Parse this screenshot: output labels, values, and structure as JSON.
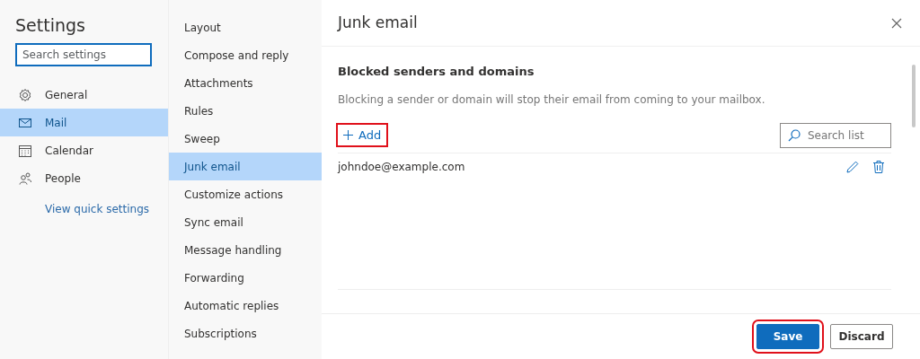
{
  "sidebar": {
    "title": "Settings",
    "search": {
      "placeholder": "Search settings"
    },
    "items": [
      {
        "label": "General",
        "kind": "gear",
        "selected": false
      },
      {
        "label": "Mail",
        "kind": "mail",
        "selected": true
      },
      {
        "label": "Calendar",
        "kind": "calendar",
        "selected": false
      },
      {
        "label": "People",
        "kind": "people",
        "selected": false
      }
    ],
    "link": "View quick settings"
  },
  "subnav": {
    "items": [
      {
        "label": "Layout",
        "selected": false
      },
      {
        "label": "Compose and reply",
        "selected": false
      },
      {
        "label": "Attachments",
        "selected": false
      },
      {
        "label": "Rules",
        "selected": false
      },
      {
        "label": "Sweep",
        "selected": false
      },
      {
        "label": "Junk email",
        "selected": true
      },
      {
        "label": "Customize actions",
        "selected": false
      },
      {
        "label": "Sync email",
        "selected": false
      },
      {
        "label": "Message handling",
        "selected": false
      },
      {
        "label": "Forwarding",
        "selected": false
      },
      {
        "label": "Automatic replies",
        "selected": false
      },
      {
        "label": "Subscriptions",
        "selected": false
      }
    ]
  },
  "panel": {
    "title": "Junk email",
    "section_title": "Blocked senders and domains",
    "description": "Blocking a sender or domain will stop their email from coming to your mailbox.",
    "add_button": {
      "label": "Add",
      "highlighted": true
    },
    "search": {
      "placeholder": "Search list"
    },
    "entries": [
      "johndoe@example.com"
    ],
    "buttons": [
      {
        "label": "Save",
        "kind": "primary",
        "highlighted": true
      },
      {
        "label": "Discard",
        "kind": "secondary",
        "highlighted": false
      }
    ]
  }
}
